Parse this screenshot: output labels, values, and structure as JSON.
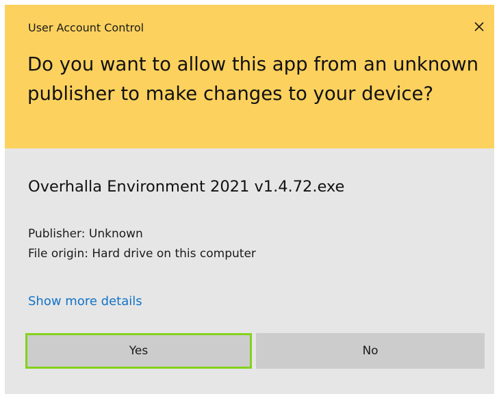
{
  "window": {
    "title": "User Account Control",
    "close_icon": "close-icon"
  },
  "prompt": {
    "question": "Do you want to allow this app from an unknown publisher to make changes to your device?"
  },
  "app": {
    "name": "Overhalla Environment 2021 v1.4.72.exe",
    "publisher": "Publisher: Unknown",
    "file_origin": "File origin: Hard drive on this computer"
  },
  "details_link": "Show more details",
  "buttons": {
    "yes_label": "Yes",
    "no_label": "No"
  },
  "colors": {
    "header_background": "#fcd15e",
    "body_background": "#e6e6e6",
    "button_background": "#cccccc",
    "focus_border": "#84d21c",
    "link": "#1273c6"
  }
}
